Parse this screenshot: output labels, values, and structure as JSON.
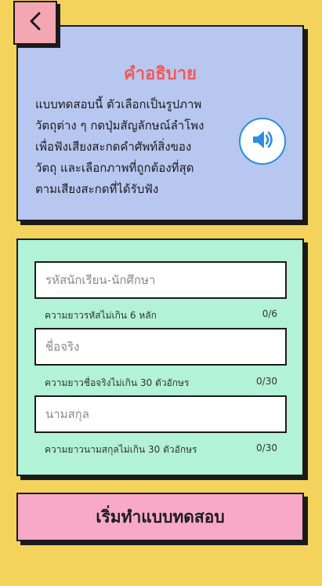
{
  "colors": {
    "background": "#f3d35b",
    "back_button": "#f4a7b3",
    "info_card": "#b8c7f0",
    "info_title": "#ee5a57",
    "form_card": "#b2f2d6",
    "start_button": "#f8a9c7",
    "speaker_accent": "#2b8ee0"
  },
  "icons": {
    "back": "chevron-left-icon",
    "speaker": "speaker-icon"
  },
  "info": {
    "title": "คำอธิบาย",
    "lines": [
      "แบบทดสอบนี้ ตัวเลือกเป็นรูปภาพ",
      "วัตถุต่าง ๆ กดปุ่มสัญลักษณ์ลำโพง",
      "เพื่อฟังเสียงสะกดคำศัพท์สิ่งของ",
      "วัตถุ และเลือกภาพที่ถูกต้องที่สุด",
      "ตามเสียงสะกดที่ได้รับฟัง"
    ]
  },
  "form": {
    "student_id": {
      "placeholder": "รหัสนักเรียน-นักศึกษา",
      "value": "",
      "helper": "ความยาวรหัสไม่เกิน 6 หลัก",
      "counter": "0/6"
    },
    "first_name": {
      "placeholder": "ชื่อจริง",
      "value": "",
      "helper": "ความยาวชื่อจริงไม่เกิน 30 ตัวอักษร",
      "counter": "0/30"
    },
    "last_name": {
      "placeholder": "นามสกุล",
      "value": "",
      "helper": "ความยาวนามสกุลไม่เกิน 30 ตัวอักษร",
      "counter": "0/30"
    }
  },
  "start_button": {
    "label": "เริ่มทำแบบทดสอบ"
  }
}
